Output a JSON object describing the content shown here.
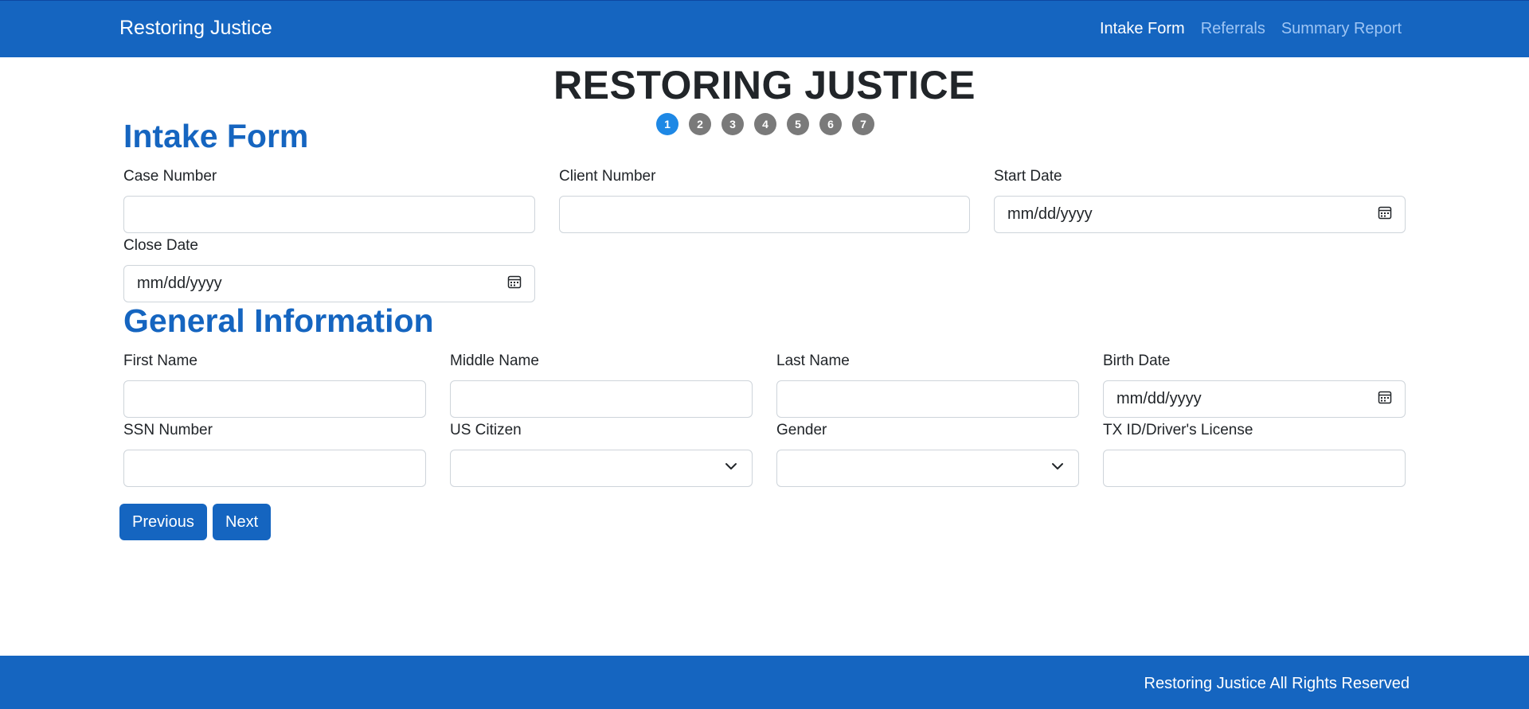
{
  "nav": {
    "brand": "Restoring Justice",
    "links": [
      {
        "label": "Intake Form",
        "active": true
      },
      {
        "label": "Referrals",
        "active": false
      },
      {
        "label": "Summary Report",
        "active": false
      }
    ]
  },
  "page_title": "RESTORING JUSTICE",
  "steps": [
    "1",
    "2",
    "3",
    "4",
    "5",
    "6",
    "7"
  ],
  "active_step": 1,
  "intake": {
    "title": "Intake Form",
    "case_number_label": "Case Number",
    "case_number_value": "",
    "client_number_label": "Client Number",
    "client_number_value": "",
    "start_date_label": "Start Date",
    "start_date_value": "mm/dd/yyyy",
    "close_date_label": "Close Date",
    "close_date_value": "mm/dd/yyyy"
  },
  "general": {
    "title": "General Information",
    "first_name_label": "First Name",
    "middle_name_label": "Middle Name",
    "last_name_label": "Last Name",
    "birth_date_label": "Birth Date",
    "birth_date_value": "mm/dd/yyyy",
    "ssn_label": "SSN Number",
    "us_citizen_label": "US Citizen",
    "us_citizen_value": "",
    "gender_label": "Gender",
    "gender_value": "",
    "tx_id_label": "TX ID/Driver's License"
  },
  "buttons": {
    "previous": "Previous",
    "next": "Next"
  },
  "footer": {
    "text": "Restoring Justice All Rights Reserved"
  },
  "colors": {
    "primary": "#1565c0",
    "active_step": "#1e88e5",
    "inactive_step": "#7a7a7a"
  }
}
